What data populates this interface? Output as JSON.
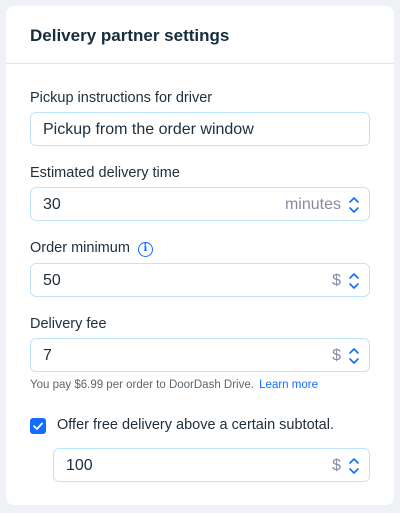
{
  "panel": {
    "title": "Delivery partner settings"
  },
  "pickup": {
    "label": "Pickup instructions for driver",
    "value": "Pickup from the order window"
  },
  "delivery_time": {
    "label": "Estimated delivery time",
    "value": "30",
    "suffix": "minutes"
  },
  "order_minimum": {
    "label": "Order minimum",
    "info_icon": "info-icon",
    "value": "50",
    "suffix": "$"
  },
  "delivery_fee": {
    "label": "Delivery fee",
    "value": "7",
    "suffix": "$",
    "helper_text": "You pay $6.99 per order to DoorDash Drive.",
    "helper_link": "Learn more"
  },
  "free_delivery": {
    "checked": true,
    "label": "Offer free delivery above a certain subtotal.",
    "value": "100",
    "suffix": "$"
  },
  "colors": {
    "accent": "#116dff",
    "input_border": "#c1e4fe",
    "text": "#20303c",
    "muted": "#868aa5"
  }
}
